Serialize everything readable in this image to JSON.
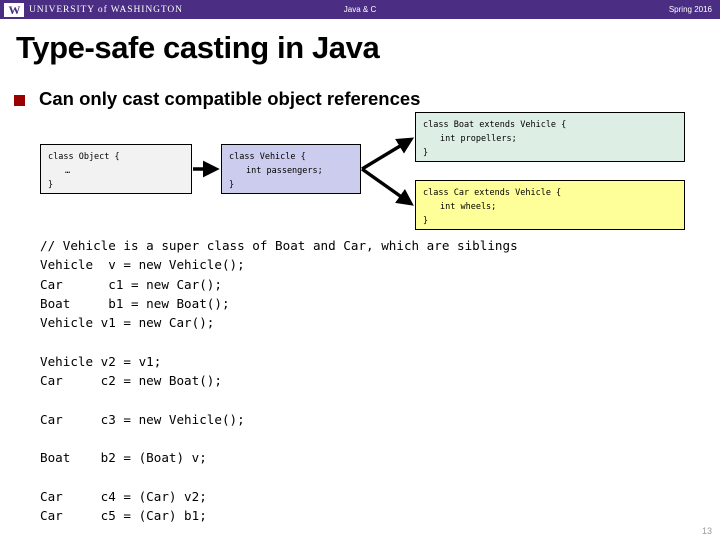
{
  "header": {
    "institution": "UNIVERSITY of WASHINGTON",
    "logo_letter": "W",
    "course": "Java & C",
    "term": "Spring 2016",
    "bar_color": "#4b2e83"
  },
  "slide": {
    "title": "Type-safe casting in Java",
    "bullet": "Can only cast compatible object references",
    "bullet_color": "#990000",
    "page_number": "13"
  },
  "diagram": {
    "boxes": [
      {
        "id": "object",
        "name": "Object",
        "color": "#f2f2f2",
        "line1": "class Object {",
        "line2": "…",
        "line3": "}"
      },
      {
        "id": "vehicle",
        "name": "Vehicle",
        "color": "#ccccee",
        "line1": "class Vehicle {",
        "line2": "int passengers;",
        "line3": "}"
      },
      {
        "id": "boat",
        "name": "Boat",
        "color": "#ddeee5",
        "line1": "class Boat extends Vehicle {",
        "line2": "int propellers;",
        "line3": "}"
      },
      {
        "id": "car",
        "name": "Car",
        "color": "#ffff99",
        "line1": "class Car extends Vehicle {",
        "line2": "int wheels;",
        "line3": "}"
      }
    ],
    "arrow_color": "#000000"
  },
  "code": {
    "lines": [
      "// Vehicle is a super class of Boat and Car, which are siblings",
      "Vehicle  v = new Vehicle();",
      "Car      c1 = new Car();",
      "Boat     b1 = new Boat();",
      "Vehicle v1 = new Car();",
      "",
      "Vehicle v2 = v1;",
      "Car     c2 = new Boat();",
      "",
      "Car     c3 = new Vehicle();",
      "",
      "Boat    b2 = (Boat) v;",
      "",
      "Car     c4 = (Car) v2;",
      "Car     c5 = (Car) b1;"
    ]
  }
}
